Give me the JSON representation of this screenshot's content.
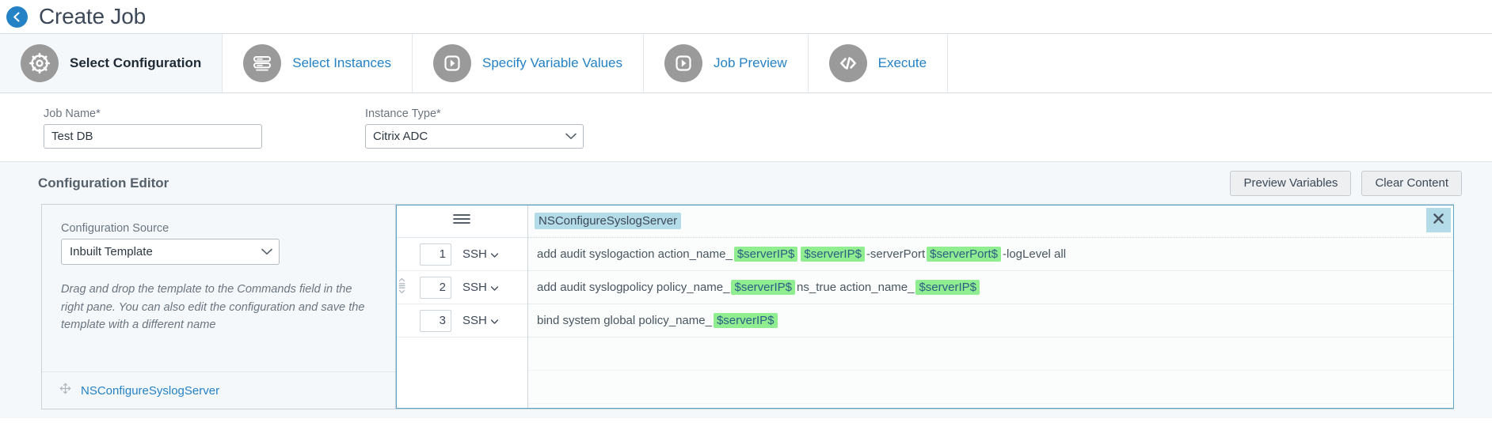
{
  "header": {
    "title": "Create Job",
    "back_icon": "arrow-left-circle-icon",
    "accent": "#2482c5"
  },
  "wizard": {
    "tabs": [
      {
        "label": "Select Configuration",
        "icon": "gear-icon",
        "active": true
      },
      {
        "label": "Select Instances",
        "icon": "server-stack-icon",
        "active": false
      },
      {
        "label": "Specify Variable Values",
        "icon": "play-square-icon",
        "active": false
      },
      {
        "label": "Job Preview",
        "icon": "play-square-icon",
        "active": false
      },
      {
        "label": "Execute",
        "icon": "code-brackets-icon",
        "active": false
      }
    ]
  },
  "form": {
    "job_name": {
      "label": "Job Name*",
      "value": "Test DB",
      "placeholder": ""
    },
    "instance_type": {
      "label": "Instance Type*",
      "value": "Citrix ADC",
      "caret_icon": "chevron-down-icon"
    }
  },
  "config_editor": {
    "title": "Configuration Editor",
    "preview_variables_label": "Preview Variables",
    "clear_content_label": "Clear Content",
    "left_pane": {
      "source_label": "Configuration Source",
      "source_value": "Inbuilt Template",
      "source_caret_icon": "chevron-down-icon",
      "hint": "Drag and drop the template to the Commands field in the right pane. You can also edit the configuration and save the template with a different name",
      "templates": [
        {
          "name": "NSConfigureSyslogServer",
          "drag_icon": "move-arrows-icon"
        }
      ]
    },
    "right_pane": {
      "menu_icon": "hamburger-menu-icon",
      "close_icon": "close-icon",
      "template_chip": "NSConfigureSyslogServer",
      "protocol_label": "SSH",
      "protocol_caret_icon": "caret-down-icon",
      "rows": [
        {
          "line": "1",
          "protocol": "SSH",
          "drag_handle": false,
          "tokens": [
            {
              "t": "text",
              "v": "add audit syslogaction action_name_"
            },
            {
              "t": "var",
              "v": "$serverIP$"
            },
            {
              "t": "var",
              "v": "$serverIP$"
            },
            {
              "t": "text",
              "v": " -serverPort "
            },
            {
              "t": "var",
              "v": "$serverPort$"
            },
            {
              "t": "text",
              "v": " -logLevel all"
            }
          ]
        },
        {
          "line": "2",
          "protocol": "SSH",
          "drag_handle": true,
          "tokens": [
            {
              "t": "text",
              "v": "add audit syslogpolicy policy_name_"
            },
            {
              "t": "var",
              "v": "$serverIP$"
            },
            {
              "t": "text",
              "v": " ns_true action_name_"
            },
            {
              "t": "var",
              "v": "$serverIP$"
            }
          ]
        },
        {
          "line": "3",
          "protocol": "SSH",
          "drag_handle": false,
          "tokens": [
            {
              "t": "text",
              "v": "bind system global policy_name_"
            },
            {
              "t": "var",
              "v": "$serverIP$"
            }
          ]
        }
      ]
    }
  },
  "colors": {
    "link": "#2482c5",
    "var_chip_bg": "#90ee90",
    "template_chip_bg": "#b4dce8",
    "panel_bg": "#f5f8fa"
  }
}
